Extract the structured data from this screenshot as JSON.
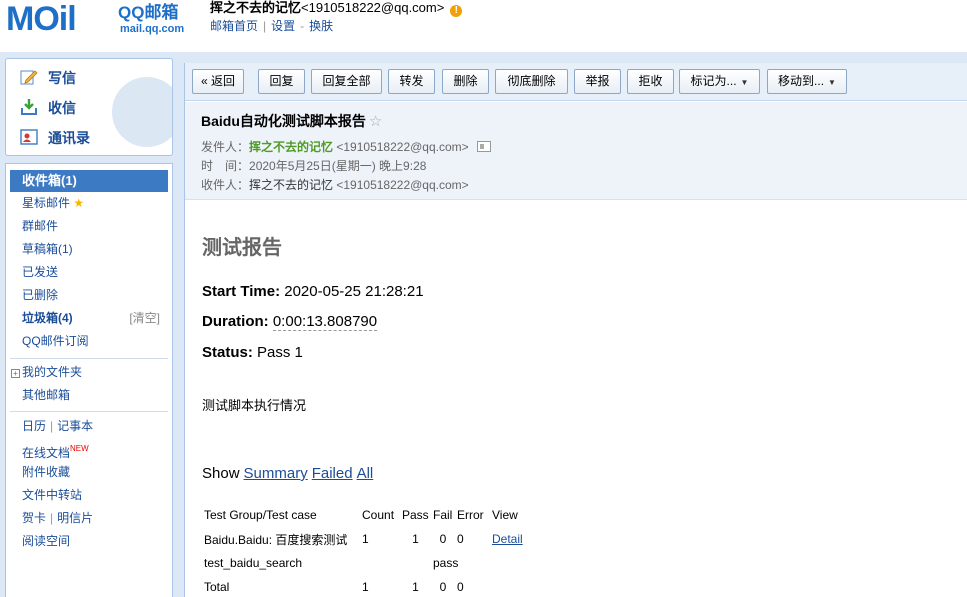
{
  "header": {
    "logo_mail": "MOil",
    "logo_qq": "QQ邮箱",
    "logo_url": "mail.qq.com",
    "user_name": "挥之不去的记忆",
    "user_email": "<1910518222@qq.com>",
    "links": [
      "邮箱首页",
      "设置",
      "换肤"
    ]
  },
  "sidebar": {
    "actions": {
      "write": "写信",
      "receive": "收信",
      "contacts": "通讯录"
    },
    "folders": {
      "inbox": "收件箱(1)",
      "starred": "星标邮件",
      "group": "群邮件",
      "drafts": "草稿箱(1)",
      "sent": "已发送",
      "deleted": "已删除",
      "spam": "垃圾箱(4)",
      "spam_clear": "[清空]",
      "subscriptions": "QQ邮件订阅",
      "my_folders": "我的文件夹",
      "other_mailbox": "其他邮箱",
      "calendar": "日历",
      "notepad": "记事本",
      "online_docs": "在线文档",
      "new_tag": "NEW",
      "attachments": "附件收藏",
      "file_transfer": "文件中转站",
      "greeting_card": "贺卡",
      "postcard": "明信片",
      "reading_space": "阅读空间"
    }
  },
  "toolbar": {
    "back": "« 返回",
    "reply": "回复",
    "reply_all": "回复全部",
    "forward": "转发",
    "delete": "删除",
    "delete_forever": "彻底删除",
    "report": "举报",
    "reject": "拒收",
    "mark_as": "标记为...",
    "move_to": "移动到..."
  },
  "mail": {
    "subject": "Baidu自动化测试脚本报告",
    "from_label": "发件人：",
    "from_name": "挥之不去的记忆",
    "from_addr": "<1910518222@qq.com>",
    "time_label": "时　间：",
    "time_value": "2020年5月25日(星期一) 晚上9:28",
    "to_label": "收件人：",
    "to_name": "挥之不去的记忆",
    "to_addr": "<1910518222@qq.com>"
  },
  "report": {
    "title": "测试报告",
    "start_label": "Start Time:",
    "start_value": "2020-05-25 21:28:21",
    "duration_label": "Duration:",
    "duration_value": "0:00:13.808790",
    "status_label": "Status:",
    "status_value": "Pass 1",
    "exec_desc": "测试脚本执行情况",
    "show_label": "Show",
    "show_summary": "Summary",
    "show_failed": "Failed",
    "show_all": "All",
    "table": {
      "headers": [
        "Test Group/Test case",
        "Count",
        "Pass",
        "Fail",
        "Error",
        "View"
      ],
      "rows": [
        [
          "Baidu.Baidu: 百度搜索测试",
          "1",
          "1",
          "0",
          "0",
          "Detail"
        ],
        [
          "test_baidu_search",
          "",
          "",
          "pass",
          "",
          ""
        ],
        [
          "Total",
          "1",
          "1",
          "0",
          "0",
          ""
        ]
      ]
    }
  }
}
